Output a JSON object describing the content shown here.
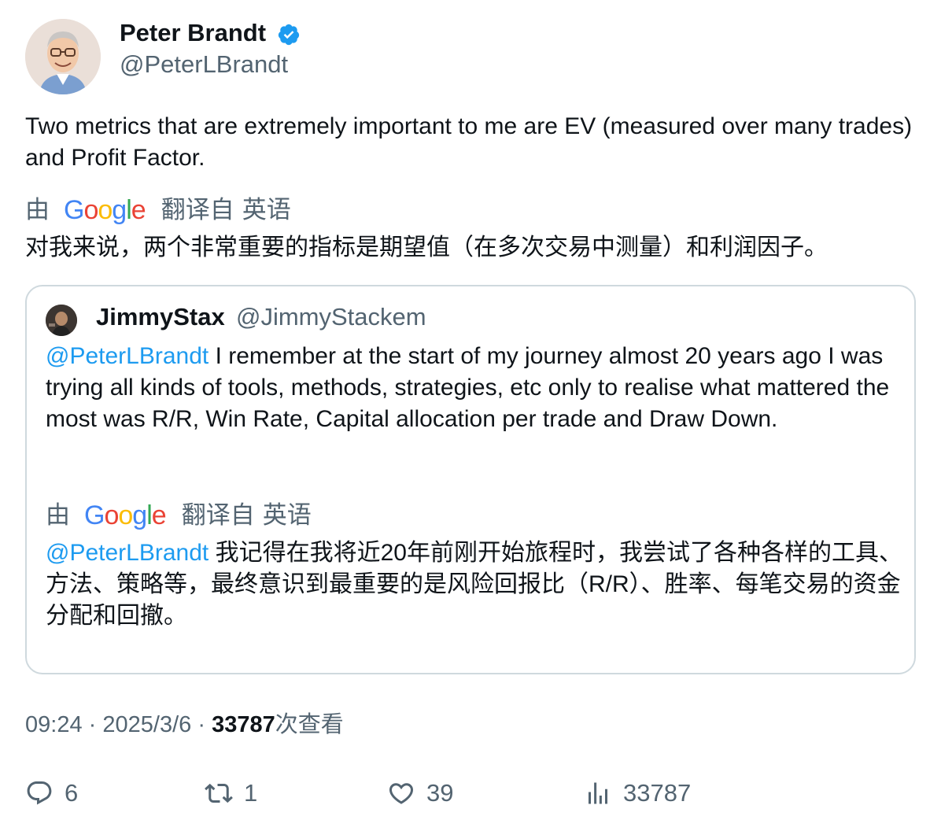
{
  "author": {
    "name": "Peter Brandt",
    "handle": "@PeterLBrandt",
    "verified": true
  },
  "tweet": {
    "text": "Two metrics that are extremely important to me are EV (measured over many trades) and Profit Factor.",
    "translation": {
      "by": "由",
      "provider": "Google",
      "from_label": "翻译自",
      "language": "英语",
      "text": "对我来说，两个非常重要的指标是期望值（在多次交易中测量）和利润因子。"
    }
  },
  "quoted": {
    "name": "JimmyStax",
    "handle": "@JimmyStackem",
    "mention": "@PeterLBrandt",
    "text": " I remember at the start of my journey almost 20 years ago I was trying all kinds of tools, methods, strategies, etc only to realise what mattered the most was R/R, Win Rate, Capital allocation per trade and Draw Down.",
    "translation": {
      "by": "由",
      "provider": "Google",
      "from_label": "翻译自",
      "language": "英语",
      "mention": "@PeterLBrandt",
      "text": " 我记得在我将近20年前刚开始旅程时，我尝试了各种各样的工具、方法、策略等，最终意识到最重要的是风险回报比（R/R）、胜率、每笔交易的资金分配和回撤。"
    }
  },
  "meta": {
    "time": "09:24",
    "sep": "·",
    "date": "2025/3/6",
    "views": "33787",
    "views_label": "次查看"
  },
  "actions": {
    "replies": "6",
    "retweets": "1",
    "likes": "39",
    "views": "33787"
  },
  "colors": {
    "accent": "#1d9bf0",
    "secondary_text": "#536471",
    "border": "#cfd9de"
  },
  "icons": [
    "verified-badge-icon",
    "reply-icon",
    "retweet-icon",
    "like-icon",
    "views-icon",
    "google-logo"
  ]
}
